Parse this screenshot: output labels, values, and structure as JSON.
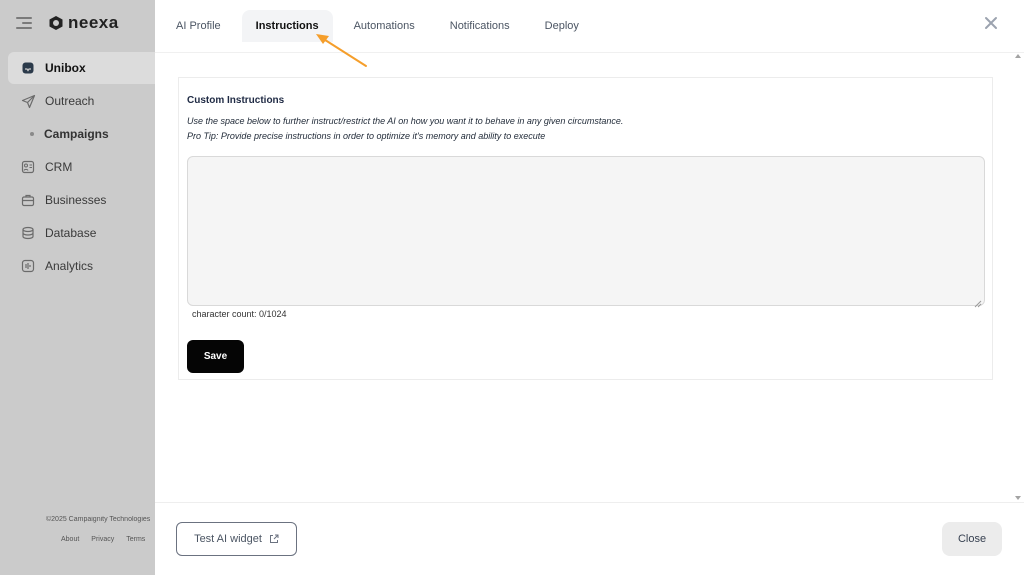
{
  "sidebar": {
    "logo_text": "neexa",
    "items": [
      {
        "label": "Unibox",
        "icon": "inbox-icon"
      },
      {
        "label": "Outreach",
        "icon": "send-icon"
      },
      {
        "label": "Campaigns",
        "icon": "bullet-dot"
      },
      {
        "label": "CRM",
        "icon": "crm-icon"
      },
      {
        "label": "Businesses",
        "icon": "briefcase-icon"
      },
      {
        "label": "Database",
        "icon": "database-icon"
      },
      {
        "label": "Analytics",
        "icon": "analytics-icon"
      }
    ],
    "active_item": "Unibox",
    "footer_copyright": "©2025 Campaignity Technologies",
    "footer_links": [
      "About",
      "Privacy",
      "Terms"
    ]
  },
  "modal": {
    "tabs": [
      "AI Profile",
      "Instructions",
      "Automations",
      "Notifications",
      "Deploy"
    ],
    "active_tab": "Instructions",
    "card": {
      "title": "Custom Instructions",
      "description_line1": "Use the space below to further instruct/restrict the AI on how you want it to behave in any given circumstance.",
      "description_line2": "Pro Tip: Provide precise instructions in order to optimize it's memory and ability to execute",
      "textarea_value": "",
      "char_count": "character count: 0/1024",
      "save_label": "Save"
    },
    "footer": {
      "test_label": "Test AI widget",
      "close_label": "Close"
    }
  },
  "colors": {
    "annotation_arrow": "#f59e2b",
    "save_button": "#050505",
    "overlay_sidebar": "#cbcbcb"
  }
}
